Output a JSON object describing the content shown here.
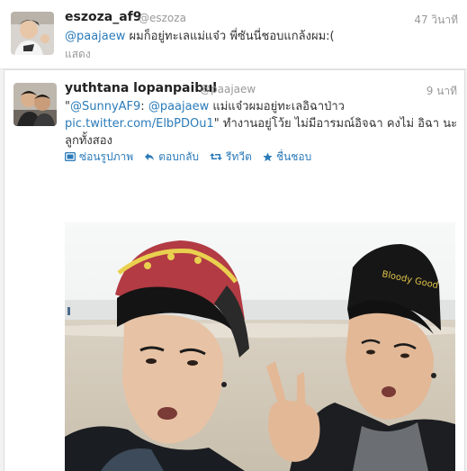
{
  "tweet1": {
    "name": "eszoza_af9",
    "handle": "@eszoza",
    "time": "47 วินาที",
    "mention": "@paajaew",
    "text": " ผมก็อยู่ทะเลแม่แจ๋ว พี่ซันนี่ชอบแกล้งผม:(",
    "expand": "แสดง"
  },
  "tweet2": {
    "name": "yuthtana lopanpaibul",
    "handle": "@paajaew",
    "time": "9 นาที",
    "line1_pre": "\"",
    "line1_link1": "@SunnyAF9",
    "line1_mid": ": ",
    "line1_link2": "@paajaew",
    "line1_post": " แม่แจ๋วผมอยู่ทะเลอิฉาป่าว",
    "line2_link": "pic.twitter.com/ElbPDOu1",
    "line2_post": "\" ทำงานอยู่โว้ย ไม่มีอารมณ์อิจฉา คงไม่ อิฉา นะ",
    "line3": "ลูกทั้งสอง",
    "actions": {
      "hide_photo": "ซ่อนรูปภาพ",
      "reply": "ตอบกลับ",
      "retweet": "รีทวีต",
      "favorite": "ชื่นชอบ"
    },
    "photo": {
      "beanie_text": "Bloody Good"
    }
  },
  "colors": {
    "link": "#2b7bb9",
    "muted": "#999999",
    "background": "#f2f2f2"
  },
  "icons": [
    "photo-icon",
    "reply-arrow-icon",
    "retweet-icon",
    "star-icon"
  ]
}
